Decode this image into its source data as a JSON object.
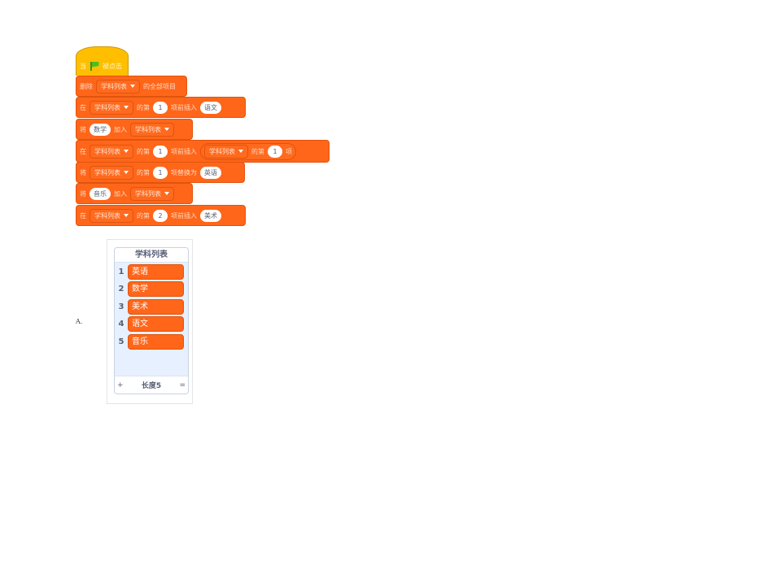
{
  "script": {
    "hat": {
      "prefix": "当",
      "icon": "green-flag-icon",
      "suffix": "被点击"
    },
    "blocks": [
      {
        "parts": [
          {
            "t": "text",
            "v": "删除"
          },
          {
            "t": "dropdown",
            "v": "学科列表"
          },
          {
            "t": "text",
            "v": "的全部项目"
          }
        ]
      },
      {
        "parts": [
          {
            "t": "text",
            "v": "在"
          },
          {
            "t": "dropdown",
            "v": "学科列表"
          },
          {
            "t": "text",
            "v": "的第"
          },
          {
            "t": "pill",
            "v": "1"
          },
          {
            "t": "text",
            "v": "项前插入"
          },
          {
            "t": "pill",
            "v": "语文"
          }
        ]
      },
      {
        "parts": [
          {
            "t": "text",
            "v": "将"
          },
          {
            "t": "pill",
            "v": "数学"
          },
          {
            "t": "text",
            "v": "加入"
          },
          {
            "t": "dropdown",
            "v": "学科列表"
          }
        ]
      },
      {
        "parts": [
          {
            "t": "text",
            "v": "在"
          },
          {
            "t": "dropdown",
            "v": "学科列表"
          },
          {
            "t": "text",
            "v": "的第"
          },
          {
            "t": "pill",
            "v": "1"
          },
          {
            "t": "text",
            "v": "项前插入"
          },
          {
            "t": "reporter",
            "v": [
              {
                "t": "dropdown",
                "v": "学科列表"
              },
              {
                "t": "text",
                "v": "的第"
              },
              {
                "t": "pill",
                "v": "1"
              },
              {
                "t": "text",
                "v": "项"
              }
            ]
          }
        ]
      },
      {
        "parts": [
          {
            "t": "text",
            "v": "将"
          },
          {
            "t": "dropdown",
            "v": "学科列表"
          },
          {
            "t": "text",
            "v": "的第"
          },
          {
            "t": "pill",
            "v": "1"
          },
          {
            "t": "text",
            "v": "项替换为"
          },
          {
            "t": "pill",
            "v": "英语"
          }
        ]
      },
      {
        "parts": [
          {
            "t": "text",
            "v": "将"
          },
          {
            "t": "pill",
            "v": "音乐"
          },
          {
            "t": "text",
            "v": "加入"
          },
          {
            "t": "dropdown",
            "v": "学科列表"
          }
        ]
      },
      {
        "parts": [
          {
            "t": "text",
            "v": "在"
          },
          {
            "t": "dropdown",
            "v": "学科列表"
          },
          {
            "t": "text",
            "v": "的第"
          },
          {
            "t": "pill",
            "v": "2"
          },
          {
            "t": "text",
            "v": "项前插入"
          },
          {
            "t": "pill",
            "v": "美术"
          }
        ]
      }
    ]
  },
  "option_label": "A.",
  "list_monitor": {
    "title": "学科列表",
    "items": [
      {
        "index": "1",
        "value": "英语"
      },
      {
        "index": "2",
        "value": "数学"
      },
      {
        "index": "3",
        "value": "美术"
      },
      {
        "index": "4",
        "value": "语文"
      },
      {
        "index": "5",
        "value": "音乐"
      }
    ],
    "add_symbol": "+",
    "length_label": "长度5",
    "resize_symbol": "="
  },
  "colors": {
    "control_orange": "#ff6619",
    "event_yellow": "#ffbf00",
    "monitor_bg": "#e6f0ff"
  }
}
